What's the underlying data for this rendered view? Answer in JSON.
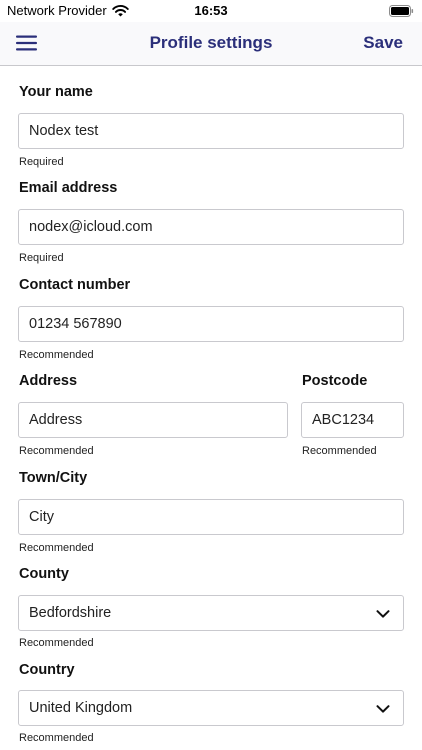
{
  "status_bar": {
    "carrier": "Network Provider",
    "time": "16:53"
  },
  "nav": {
    "title": "Profile settings",
    "save_label": "Save"
  },
  "form": {
    "name": {
      "label": "Your name",
      "value": "Nodex test",
      "hint": "Required"
    },
    "email": {
      "label": "Email address",
      "value": "nodex@icloud.com",
      "hint": "Required"
    },
    "phone": {
      "label": "Contact number",
      "value": "01234 567890",
      "hint": "Recommended"
    },
    "address": {
      "label": "Address",
      "value": "Address",
      "hint": "Recommended"
    },
    "postcode": {
      "label": "Postcode",
      "value": "ABC1234",
      "hint": "Recommended"
    },
    "town": {
      "label": "Town/City",
      "value": "City",
      "hint": "Recommended"
    },
    "county": {
      "label": "County",
      "value": "Bedfordshire",
      "hint": "Recommended"
    },
    "country": {
      "label": "Country",
      "value": "United Kingdom",
      "hint": "Recommended"
    }
  },
  "colors": {
    "accent": "#2b2f7a",
    "border": "#c9c9ce",
    "nav_background": "#f9f9fb"
  },
  "icons": [
    "wifi-icon",
    "battery-icon",
    "menu-icon",
    "chevron-down-icon"
  ]
}
